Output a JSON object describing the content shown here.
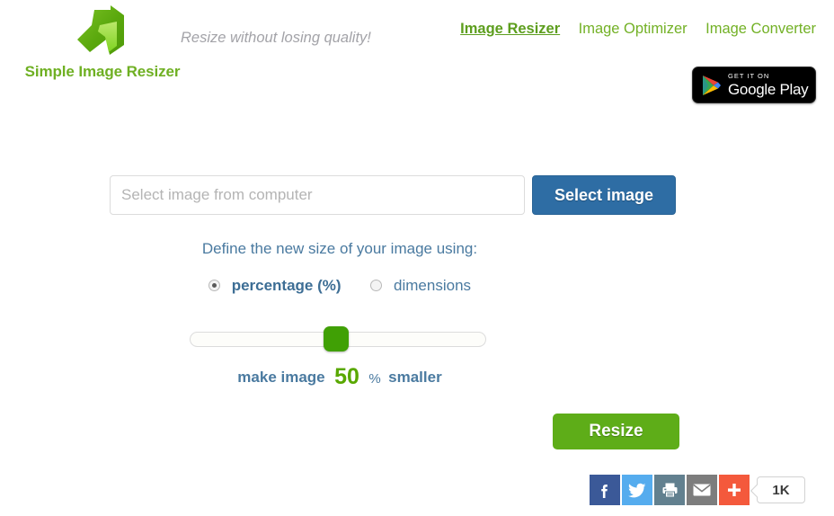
{
  "header": {
    "brand_name": "Simple Image Resizer",
    "logo_icon": "green-resize-arrow-logo",
    "tagline": "Resize without losing quality!",
    "nav": [
      {
        "label": "Image Resizer",
        "active": true
      },
      {
        "label": "Image Optimizer",
        "active": false
      },
      {
        "label": "Image Converter",
        "active": false
      }
    ],
    "google_play": {
      "small_text": "GET IT ON",
      "big_text": "Google Play",
      "icon": "google-play-triangle-icon"
    }
  },
  "form": {
    "file_input_placeholder": "Select image from computer",
    "file_input_value": "",
    "select_button_label": "Select image",
    "define_label": "Define the new size of your image using:",
    "options": [
      {
        "label": "percentage (%)",
        "selected": true
      },
      {
        "label": "dimensions",
        "selected": false
      }
    ],
    "slider": {
      "value": 50,
      "min": 0,
      "max": 100
    },
    "percent_prefix": "make image",
    "percent_value": "50",
    "percent_sign": "%",
    "percent_suffix": "smaller",
    "resize_button_label": "Resize"
  },
  "share": {
    "buttons": [
      {
        "name": "facebook",
        "icon": "facebook-icon",
        "color": "#3b5998"
      },
      {
        "name": "twitter",
        "icon": "twitter-bird-icon",
        "color": "#55acee"
      },
      {
        "name": "print",
        "icon": "printer-icon",
        "color": "#62808f"
      },
      {
        "name": "email",
        "icon": "envelope-icon",
        "color": "#7d7d7d"
      },
      {
        "name": "more",
        "icon": "plus-icon",
        "color": "#f4593c"
      }
    ],
    "count_label": "1K"
  },
  "colors": {
    "brand_green": "#6fb023",
    "accent_green": "#5ead18",
    "slider_green": "#40a005",
    "button_blue": "#2e6da4",
    "text_blue": "#4a7aa0",
    "tagline_gray": "#a3a3a8"
  }
}
